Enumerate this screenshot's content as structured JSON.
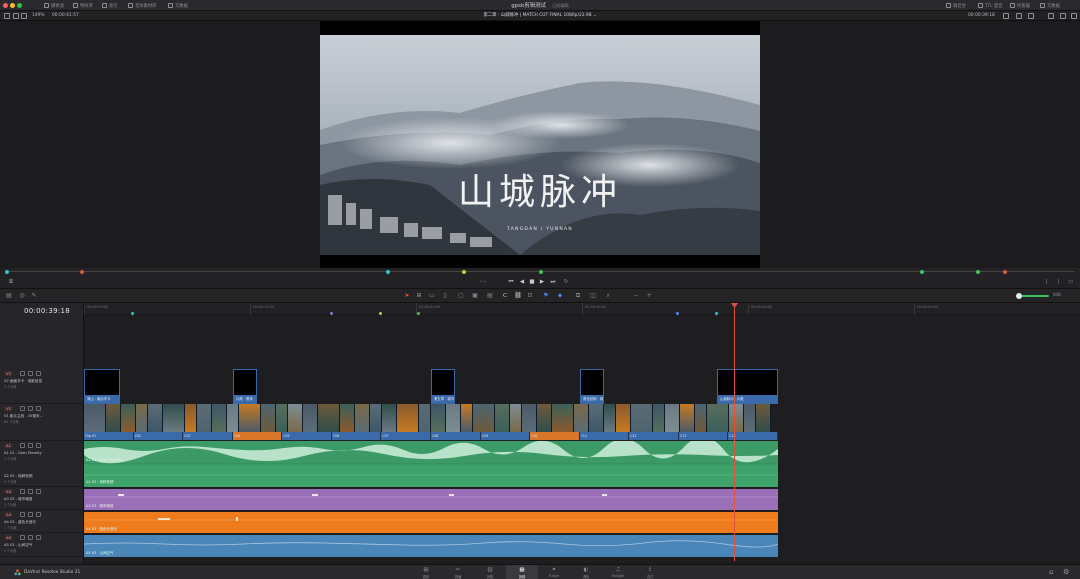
{
  "app": {
    "title": "gpsb剪辑测试",
    "subtitle": "已经编辑"
  },
  "titlebar": {
    "left_items": [
      "媒体池",
      "特效库",
      "索引",
      "音效素材库",
      "元数据"
    ],
    "right_items": [
      "调音台",
      "TTL 混音",
      "检查器",
      "元数据"
    ]
  },
  "viewer_header": {
    "zoom": "149%",
    "timecode_left": "00:00:41:57",
    "title": "第二章 · 山城脉冲 | MATCH CUT FINAL 1080p/23.98 ⌄",
    "timecode_right": "00:00:39:18"
  },
  "frame": {
    "title": "山城脉冲",
    "subtitle": "TANGDAN / YUNNAN"
  },
  "timeline": {
    "timecode": "00:00:39:18",
    "ruler": [
      "00:00:00:00",
      "00:00:10:00",
      "00:00:20:00",
      "00:00:30:00",
      "00:00:40:00",
      "00:00:50:00"
    ],
    "volume_label": "0dB"
  },
  "tracks": [
    {
      "tag": "V2",
      "name": "V2 画面字卡 · 电影信息",
      "info": "5 个片段"
    },
    {
      "tag": "V1",
      "name": "V1 影片主线 - 35毫米...",
      "info": "60 个片段"
    },
    {
      "tag": "A1",
      "name": "A1 01 - Gem Eternity",
      "info": "1 个片段"
    },
    {
      "tag": "A2",
      "name": "A2 03 - 纯粹低频",
      "info": "1 个片段"
    },
    {
      "tag": "A3",
      "name": "A3 03 - 城市噪音",
      "info": "1 个片段"
    },
    {
      "tag": "A4",
      "name": "A4 03 - 蓝色长音乐",
      "info": "1 个片段"
    },
    {
      "tag": "A5",
      "name": "A5 03 - 山间空气",
      "info": "1 个片段"
    }
  ],
  "v2_clips": [
    "清山 · 最后字卡",
    "片尾 · 黑场",
    "第五章 · 城市",
    "角色说明 · 城市",
    "山城脉冲 · 片尾"
  ],
  "v1_labels": [
    "Clip 01",
    "C02",
    "C03",
    "C04",
    "C05",
    "C06",
    "C07",
    "C08",
    "C09",
    "C10",
    "C11",
    "C12",
    "C13",
    "C14"
  ],
  "audio_clips": [
    {
      "label": "A1 01 · Gem Eternity"
    },
    {
      "label": "A2 03 · 纯粹低频"
    },
    {
      "label": "A3 03 · 城市噪音"
    },
    {
      "label": "A4 03 · 蓝色长音乐"
    },
    {
      "label": "A5 03 · 山间空气"
    }
  ],
  "pagebar": {
    "brand": "DaVinci Resolve Studio 21",
    "pages": [
      {
        "label": "媒体",
        "icon": "▤"
      },
      {
        "label": "快编",
        "icon": "✂"
      },
      {
        "label": "剪辑",
        "icon": "▥"
      },
      {
        "label": "剪辑",
        "icon": "▦"
      },
      {
        "label": "Fusion",
        "icon": "✦"
      },
      {
        "label": "调色",
        "icon": "◐"
      },
      {
        "label": "Fairlight",
        "icon": "♫"
      },
      {
        "label": "交付",
        "icon": "⇪"
      }
    ],
    "active_index": 3
  },
  "colors": {
    "accent": "#e0533c",
    "video": "#3a6aaa",
    "audio_green": "#3ea36b",
    "audio_purple": "#9b6fb7",
    "audio_orange": "#ee7c1c",
    "audio_blue": "#4a86b8"
  }
}
